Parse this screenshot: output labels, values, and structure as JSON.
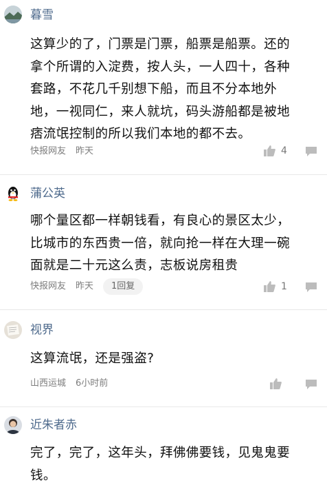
{
  "comments": [
    {
      "username": "暮雪",
      "avatar": "landscape-avatar",
      "lines": [
        "这算少的了，门票是门票，船票是船票。还的",
        "拿个所谓的入淀费，按人头，一人四十，各种",
        "套路，不花几千别想下船，而且不分本地外",
        "地，一视同仁，来人就坑，码头游船都是被地",
        "痞流氓控制的所以我们本地的都不去。"
      ],
      "source": "快报网友",
      "time": "昨天",
      "likes": "4"
    },
    {
      "username": "蒲公英",
      "avatar": "penguin-avatar",
      "lines": [
        "哪个量区都一样朝钱看，有良心的景区太少，",
        "比城市的东西贵一倍，就向抢一样在大理一碗",
        "面就是二十元这么责，志板说房租贵"
      ],
      "source": "快报网友",
      "time": "昨天",
      "reply_count": "1回复",
      "likes": "1"
    },
    {
      "username": "视界",
      "avatar": "document-avatar",
      "lines": [
        "这算流氓，还是强盗?"
      ],
      "source": "山西运城",
      "time": "6小时前"
    },
    {
      "username": "近朱者赤",
      "avatar": "person-avatar",
      "lines": [
        "完了，完了，这年头，拜佛佛要钱，见鬼鬼要",
        "钱。"
      ]
    }
  ]
}
